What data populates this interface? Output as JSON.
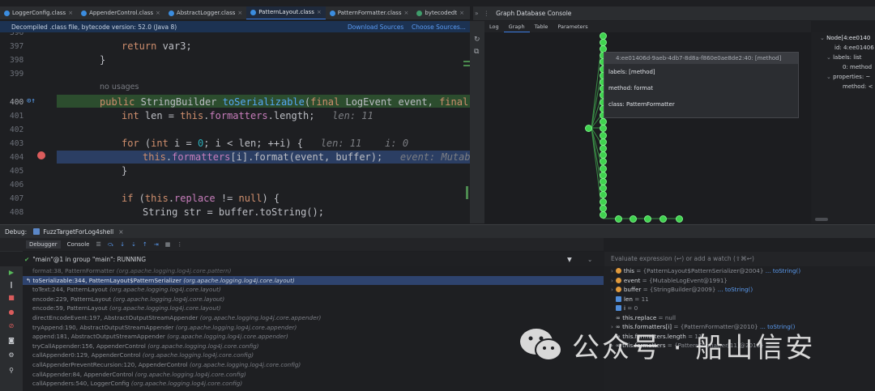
{
  "tabs": [
    {
      "label": "LoggerConfig.class",
      "active": false
    },
    {
      "label": "AppenderControl.class",
      "active": false
    },
    {
      "label": "AbstractLogger.class",
      "active": false
    },
    {
      "label": "PatternLayout.class",
      "active": true
    },
    {
      "label": "PatternFormatter.class",
      "active": false
    },
    {
      "label": "bytecodedt",
      "active": false
    }
  ],
  "banner": {
    "text": "Decompiled .class file, bytecode version: 52.0 (Java 8)",
    "download": "Download Sources",
    "choose": "Choose Sources..."
  },
  "editor": {
    "lines": [
      {
        "n": "396",
        "code": ""
      },
      {
        "n": "397",
        "code": "return var3;"
      },
      {
        "n": "398",
        "code": "}"
      },
      {
        "n": "399",
        "code": ""
      },
      {
        "n": "",
        "code": "no usages"
      },
      {
        "n": "400",
        "code": "public StringBuilder toSerializable(final LogEvent event, final StringBu"
      },
      {
        "n": "401",
        "code": "int len = this.formatters.length;",
        "hint": "len: 11"
      },
      {
        "n": "402",
        "code": ""
      },
      {
        "n": "403",
        "code": "for (int i = 0; i < len; ++i) {",
        "hint": "len: 11    i: 0"
      },
      {
        "n": "404",
        "code": "this.formatters[i].format(event, buffer);",
        "hint": "event: MutableLogEve"
      },
      {
        "n": "405",
        "code": "}"
      },
      {
        "n": "406",
        "code": ""
      },
      {
        "n": "407",
        "code": "if (this.replace != null) {"
      },
      {
        "n": "408",
        "code": "String str = buffer.toString();"
      }
    ]
  },
  "console": {
    "title": "Graph Database Console",
    "tabs": [
      "Log",
      "Graph",
      "Table",
      "Parameters"
    ],
    "active_tab": "Graph",
    "tooltip": {
      "header": "4:ee01406d-9aeb-4db7-8d8a-f860e0ae8de2:40: [method]",
      "labels": "labels: [method]",
      "method": "method: format",
      "class": "class: PatternFormatter"
    },
    "node_panel": {
      "title": "Node[4:ee0140",
      "id": "id: 4:ee01406",
      "labels": "labels: list",
      "label0": "0: method",
      "properties": "properties: ~",
      "method": "method: <"
    }
  },
  "debug": {
    "label": "Debug:",
    "config": "FuzzTargetForLog4shell",
    "tabs": [
      "Debugger",
      "Console"
    ],
    "thread": "\"main\"@1 in group \"main\": RUNNING",
    "eval_placeholder": "Evaluate expression (↩) or add a watch (⇧⌘↩)",
    "frames": [
      {
        "method": "format:38, PatternFormatter",
        "pkg": "(org.apache.logging.log4j.core.pattern)"
      },
      {
        "method": "toSerializable:344, PatternLayout$PatternSerializer",
        "pkg": "(org.apache.logging.log4j.core.layout)",
        "current": true
      },
      {
        "method": "toText:244, PatternLayout",
        "pkg": "(org.apache.logging.log4j.core.layout)"
      },
      {
        "method": "encode:229, PatternLayout",
        "pkg": "(org.apache.logging.log4j.core.layout)"
      },
      {
        "method": "encode:59, PatternLayout",
        "pkg": "(org.apache.logging.log4j.core.layout)"
      },
      {
        "method": "directEncodeEvent:197, AbstractOutputStreamAppender",
        "pkg": "(org.apache.logging.log4j.core.appender)"
      },
      {
        "method": "tryAppend:190, AbstractOutputStreamAppender",
        "pkg": "(org.apache.logging.log4j.core.appender)"
      },
      {
        "method": "append:181, AbstractOutputStreamAppender",
        "pkg": "(org.apache.logging.log4j.core.appender)"
      },
      {
        "method": "tryCallAppender:156, AppenderControl",
        "pkg": "(org.apache.logging.log4j.core.config)"
      },
      {
        "method": "callAppender0:129, AppenderControl",
        "pkg": "(org.apache.logging.log4j.core.config)"
      },
      {
        "method": "callAppenderPreventRecursion:120, AppenderControl",
        "pkg": "(org.apache.logging.log4j.core.config)"
      },
      {
        "method": "callAppender:84, AppenderControl",
        "pkg": "(org.apache.logging.log4j.core.config)"
      },
      {
        "method": "callAppenders:540, LoggerConfig",
        "pkg": "(org.apache.logging.log4j.core.config)"
      }
    ],
    "variables": [
      {
        "name": "this",
        "value": "= {PatternLayout$PatternSerializer@2004}",
        "link": "... toString()",
        "icon": "o",
        "expand": true
      },
      {
        "name": "event",
        "value": "= {MutableLogEvent@1991}",
        "link": "",
        "icon": "o",
        "expand": true
      },
      {
        "name": "buffer",
        "value": "= {StringBuilder@2009}",
        "link": "... toString()",
        "icon": "o",
        "expand": true
      },
      {
        "name": "len",
        "value": "= 11",
        "link": "",
        "icon": "p",
        "expand": false
      },
      {
        "name": "i",
        "value": "= 0",
        "link": "",
        "icon": "p",
        "expand": false
      },
      {
        "name": "this.replace",
        "value": "= null",
        "link": "",
        "icon": "oo",
        "expand": false
      },
      {
        "name": "this.formatters[i]",
        "value": "= {PatternFormatter@2010}",
        "link": "... toString()",
        "icon": "oo",
        "expand": true
      },
      {
        "name": "this.formatters.length",
        "value": "= 11",
        "link": "",
        "icon": "oo",
        "expand": false
      },
      {
        "name": "this.formatters",
        "value": "= {PatternFormatter[11]@2013}",
        "link": "",
        "icon": "oo",
        "expand": true
      }
    ]
  },
  "watermark": "公众号 · 船山信安"
}
